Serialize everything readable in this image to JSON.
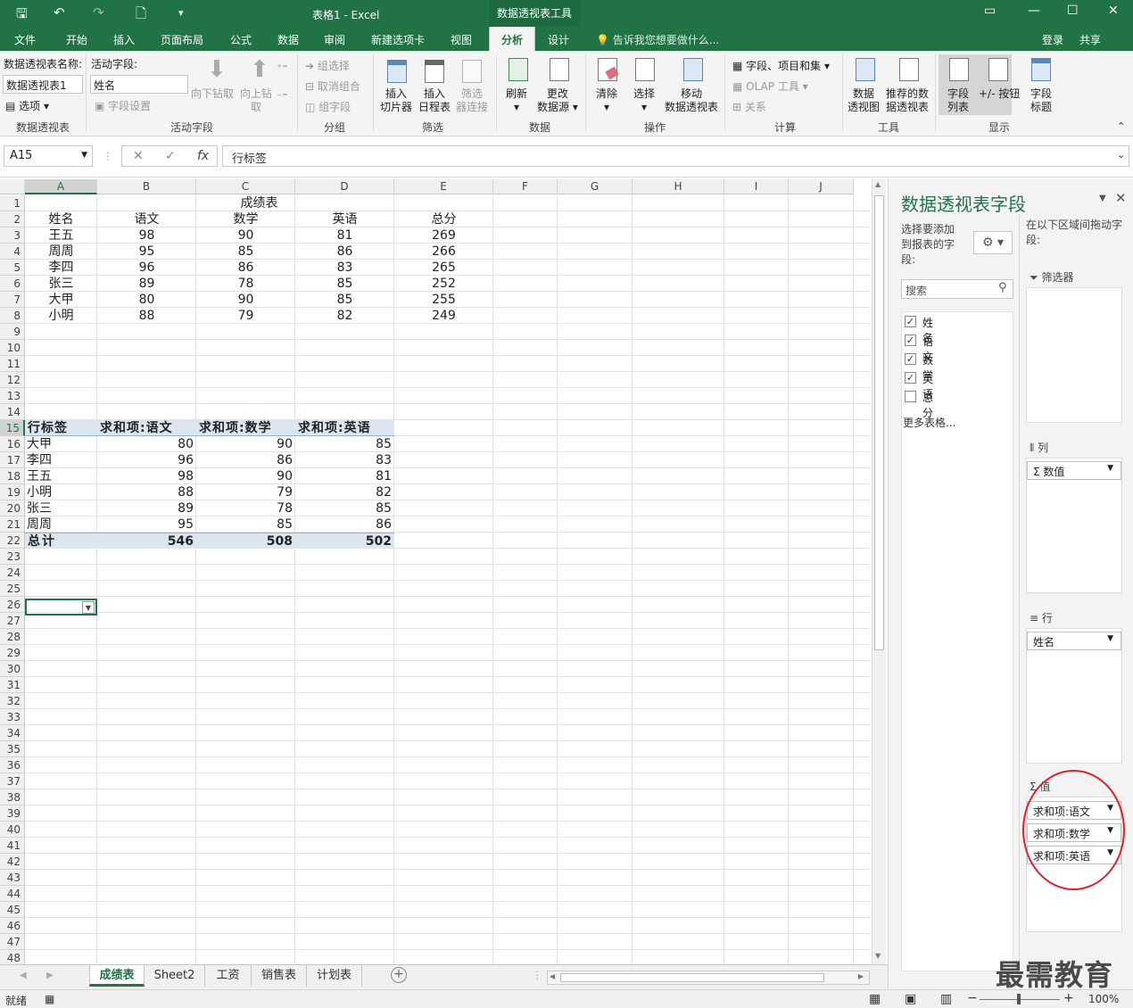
{
  "window": {
    "title": "表格1 - Excel",
    "context_tab_group": "数据透视表工具",
    "buttons": [
      "▭",
      "—",
      "☐",
      "✕"
    ]
  },
  "qat": {
    "save": "🖫",
    "undo": "↶",
    "redo": "↷",
    "new": "🗋",
    "more": "▾"
  },
  "tabs": [
    "文件",
    "开始",
    "插入",
    "页面布局",
    "公式",
    "数据",
    "审阅",
    "新建选项卡",
    "视图",
    "分析",
    "设计"
  ],
  "active_tab": "分析",
  "tell_me": "💡 告诉我您想要做什么...",
  "account": {
    "login": "登录",
    "share": "共享"
  },
  "ribbon": {
    "pivot_name_label": "数据透视表名称:",
    "pivot_name_value": "数据透视表1",
    "options": "选项",
    "group_pivot": "数据透视表",
    "active_field_label": "活动字段:",
    "active_field_value": "姓名",
    "field_settings": "字段设置",
    "drill_down": "向下钻取",
    "drill_up": "向上钻取",
    "group_active_field": "活动字段",
    "group_selection": "组选择",
    "ungroup": "取消组合",
    "group_field": "组字段",
    "group_grouping": "分组",
    "insert_slicer": [
      "插入",
      "切片器"
    ],
    "insert_timeline": [
      "插入",
      "日程表"
    ],
    "filter_connections": [
      "筛选",
      "器连接"
    ],
    "group_filter": "筛选",
    "refresh": "刷新",
    "change_source": [
      "更改",
      "数据源"
    ],
    "group_data": "数据",
    "clear": "清除",
    "select": "选择",
    "move_pivot": [
      "移动",
      "数据透视表"
    ],
    "group_actions": "操作",
    "fields_items_sets": "字段、项目和集",
    "olap_tools": "OLAP 工具",
    "relationships": "关系",
    "group_calc": "计算",
    "pivot_chart": [
      "数据",
      "透视图"
    ],
    "recommended_pivot": [
      "推荐的数",
      "据透视表"
    ],
    "group_tools": "工具",
    "field_list": [
      "字段",
      "列表"
    ],
    "plus_minus": "+/- 按钮",
    "field_headers": [
      "字段",
      "标题"
    ],
    "group_show": "显示"
  },
  "formula_bar": {
    "name_box": "A15",
    "content": "行标签",
    "icons": [
      "✕",
      "✓",
      "fx"
    ]
  },
  "columns": [
    "A",
    "B",
    "C",
    "D",
    "E",
    "F",
    "G",
    "H",
    "I",
    "J"
  ],
  "selected_column": "A",
  "selected_row": 15,
  "rows": [
    1,
    2,
    3,
    4,
    5,
    6,
    7,
    8,
    9,
    10,
    11,
    12,
    13,
    14,
    15,
    16,
    17,
    18,
    19,
    20,
    21,
    22,
    23,
    24,
    25,
    26,
    27,
    28,
    29,
    30,
    31,
    32,
    33,
    34,
    35,
    36,
    37,
    38,
    39,
    40,
    41,
    42,
    43,
    44,
    45,
    46,
    47,
    48
  ],
  "source_table": {
    "title": "成绩表",
    "headers": [
      "姓名",
      "语文",
      "数学",
      "英语",
      "总分"
    ],
    "rows": [
      [
        "王五",
        "98",
        "90",
        "81",
        "269"
      ],
      [
        "周周",
        "95",
        "85",
        "86",
        "266"
      ],
      [
        "李四",
        "96",
        "86",
        "83",
        "265"
      ],
      [
        "张三",
        "89",
        "78",
        "85",
        "252"
      ],
      [
        "大甲",
        "80",
        "90",
        "85",
        "255"
      ],
      [
        "小明",
        "88",
        "79",
        "82",
        "249"
      ]
    ]
  },
  "pivot_table": {
    "headers": [
      "行标签",
      "求和项:语文",
      "求和项:数学",
      "求和项:英语"
    ],
    "rows": [
      [
        "大甲",
        "80",
        "90",
        "85"
      ],
      [
        "李四",
        "96",
        "86",
        "83"
      ],
      [
        "王五",
        "98",
        "90",
        "81"
      ],
      [
        "小明",
        "88",
        "79",
        "82"
      ],
      [
        "张三",
        "89",
        "78",
        "85"
      ],
      [
        "周周",
        "95",
        "85",
        "86"
      ]
    ],
    "total": [
      "总计",
      "546",
      "508",
      "502"
    ]
  },
  "sheet_tabs": [
    "成绩表",
    "Sheet2",
    "工资",
    "销售表",
    "计划表"
  ],
  "active_sheet": "成绩表",
  "status": {
    "ready": "就绪",
    "zoom": "100%"
  },
  "panel": {
    "title": "数据透视表字段",
    "choose_fields": "选择要添加到报表的字段:",
    "drag_hint": "在以下区域间拖动字段:",
    "search_placeholder": "搜索",
    "fields": [
      {
        "name": "姓名",
        "checked": true
      },
      {
        "name": "语文",
        "checked": true
      },
      {
        "name": "数学",
        "checked": true
      },
      {
        "name": "英语",
        "checked": true
      },
      {
        "name": "总分",
        "checked": false
      }
    ],
    "more_tables": "更多表格...",
    "areas": {
      "filters": "筛选器",
      "columns": "列",
      "rows": "行",
      "values": "值"
    },
    "columns_items": [
      "Σ 数值"
    ],
    "rows_items": [
      "姓名"
    ],
    "values_items": [
      "求和项:语文",
      "求和项:数学",
      "求和项:英语"
    ]
  },
  "watermark": "最需教育",
  "colors": {
    "excel_green": "#217346",
    "pivot_blue": "#dce6f1",
    "annotation_red": "#e0202a"
  }
}
